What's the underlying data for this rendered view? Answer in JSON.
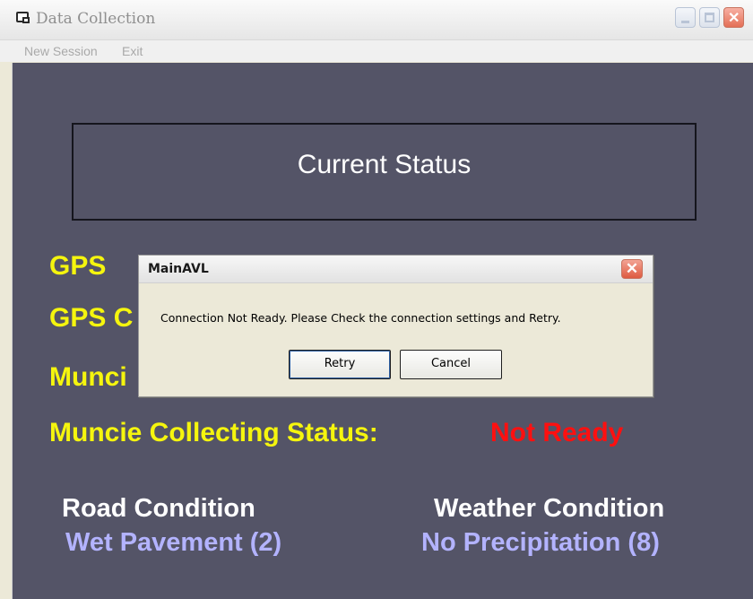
{
  "window": {
    "title": "Data Collection"
  },
  "menu": {
    "items": [
      "New Session",
      "Exit"
    ]
  },
  "status_box": {
    "title": "Current Status"
  },
  "labels": {
    "gps": "GPS",
    "gps_c": "GPS C",
    "munci": "Munci",
    "muncie_collecting": "Muncie Collecting Status:"
  },
  "muncie_status_value": "Not Ready",
  "conditions": {
    "road_label": "Road Condition",
    "road_value": "Wet Pavement (2)",
    "weather_label": "Weather Condition",
    "weather_value": "No Precipitation (8)"
  },
  "dialog": {
    "title": "MainAVL",
    "message": "Connection Not Ready. Please Check the connection settings and Retry.",
    "retry_label": "Retry",
    "cancel_label": "Cancel"
  },
  "colors": {
    "background": "#545467",
    "label_yellow": "#f5f50e",
    "status_red": "#ff1010",
    "condition_value": "#b3b3ff"
  }
}
